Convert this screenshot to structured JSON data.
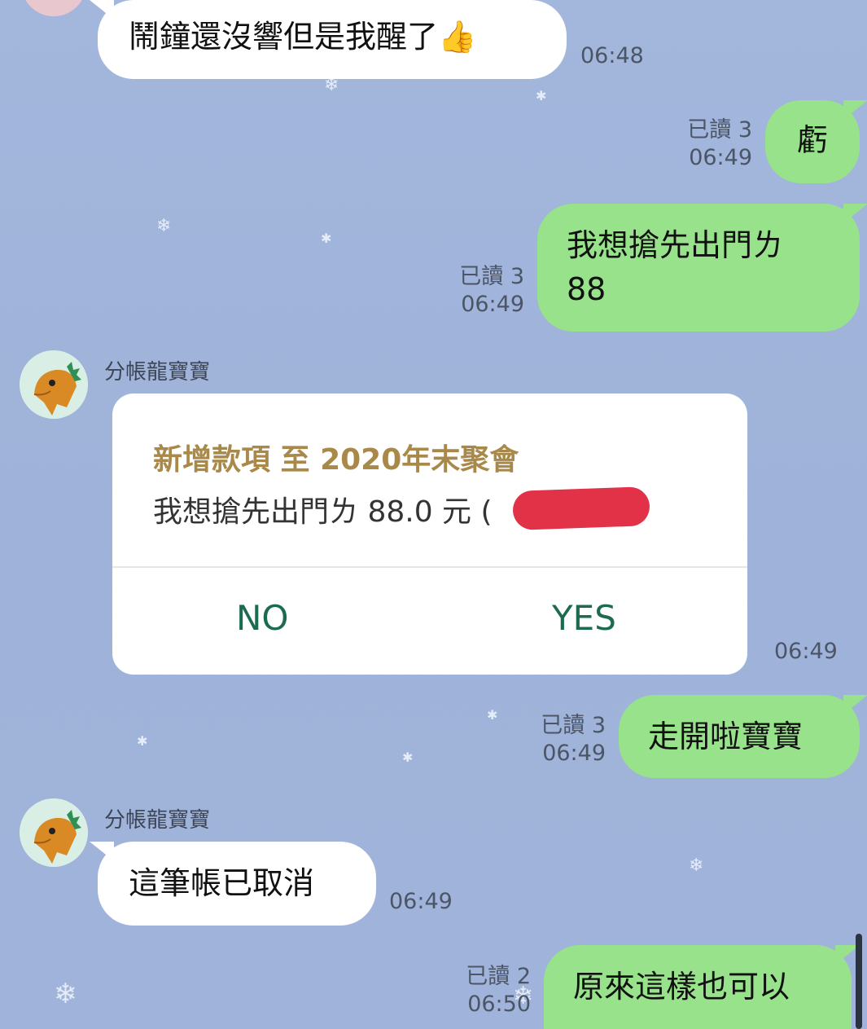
{
  "messages": [
    {
      "text": "鬧鐘還沒響但是我醒了👍",
      "time": "06:48"
    },
    {
      "text": "虧",
      "read": "已讀 3",
      "time": "06:49"
    },
    {
      "line1": "我想搶先出門ㄌ",
      "line2": "88",
      "read": "已讀 3",
      "time": "06:49"
    },
    {
      "text": "走開啦寶寶",
      "read": "已讀 3",
      "time": "06:49"
    },
    {
      "text": "這筆帳已取消",
      "time": "06:49"
    },
    {
      "text": "原來這樣也可以",
      "read": "已讀 2",
      "time": "06:50"
    }
  ],
  "bot": {
    "name": "分帳龍寶寶"
  },
  "card": {
    "title": "新增款項 至 2020年末聚會",
    "subtitle": "我想搶先出門ㄌ 88.0 元 (",
    "close_paren": ")",
    "no_label": "NO",
    "yes_label": "YES",
    "time": "06:49"
  },
  "colors": {
    "incoming": "#ffffff",
    "outgoing": "#97e28a",
    "card_title": "#a8894a",
    "card_button": "#1d6b4f"
  }
}
